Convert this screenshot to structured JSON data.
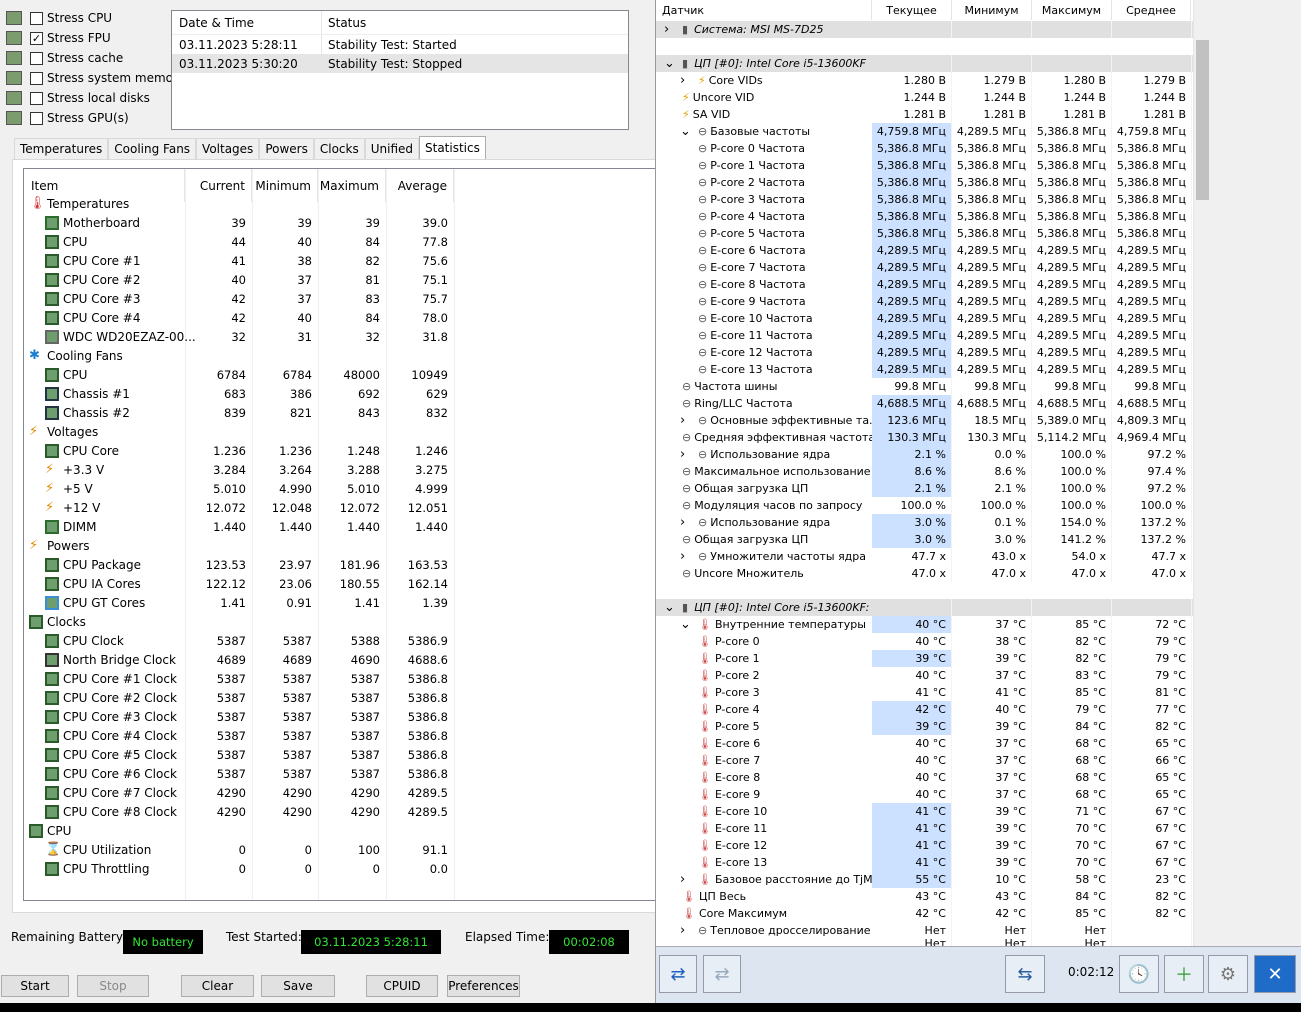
{
  "stress_options": [
    {
      "label": "Stress CPU",
      "checked": false
    },
    {
      "label": "Stress FPU",
      "checked": true
    },
    {
      "label": "Stress cache",
      "checked": false
    },
    {
      "label": "Stress system memory",
      "checked": false
    },
    {
      "label": "Stress local disks",
      "checked": false
    },
    {
      "label": "Stress GPU(s)",
      "checked": false
    }
  ],
  "events": {
    "col_datetime": "Date & Time",
    "col_status": "Status",
    "rows": [
      {
        "datetime": "03.11.2023 5:28:11",
        "status": "Stability Test: Started"
      },
      {
        "datetime": "03.11.2023 5:30:20",
        "status": "Stability Test: Stopped"
      }
    ]
  },
  "tabs": [
    "Temperatures",
    "Cooling Fans",
    "Voltages",
    "Powers",
    "Clocks",
    "Unified",
    "Statistics"
  ],
  "stats": {
    "columns": [
      "Item",
      "Current",
      "Minimum",
      "Maximum",
      "Average"
    ],
    "rows": [
      {
        "group": true,
        "name": "Temperatures",
        "icon": "thermometer-icon"
      },
      {
        "name": "Motherboard",
        "icon": "motherboard-icon",
        "v": [
          "39",
          "39",
          "39",
          "39.0"
        ]
      },
      {
        "name": "CPU",
        "icon": "chip-icon",
        "v": [
          "44",
          "40",
          "84",
          "77.8"
        ]
      },
      {
        "name": "CPU Core #1",
        "icon": "chip-icon",
        "v": [
          "41",
          "38",
          "82",
          "75.6"
        ]
      },
      {
        "name": "CPU Core #2",
        "icon": "chip-icon",
        "v": [
          "40",
          "37",
          "81",
          "75.1"
        ]
      },
      {
        "name": "CPU Core #3",
        "icon": "chip-icon",
        "v": [
          "42",
          "37",
          "83",
          "75.7"
        ]
      },
      {
        "name": "CPU Core #4",
        "icon": "chip-icon",
        "v": [
          "42",
          "40",
          "84",
          "78.0"
        ]
      },
      {
        "name": "WDC WD20EZAZ-00...",
        "icon": "disk-icon",
        "v": [
          "32",
          "31",
          "32",
          "31.8"
        ]
      },
      {
        "group": true,
        "name": "Cooling Fans",
        "icon": "fan-icon"
      },
      {
        "name": "CPU",
        "icon": "chip-icon",
        "v": [
          "6784",
          "6784",
          "48000",
          "10949"
        ]
      },
      {
        "name": "Chassis #1",
        "icon": "case-icon",
        "v": [
          "683",
          "386",
          "692",
          "629"
        ]
      },
      {
        "name": "Chassis #2",
        "icon": "case-icon",
        "v": [
          "839",
          "821",
          "843",
          "832"
        ]
      },
      {
        "group": true,
        "name": "Voltages",
        "icon": "bolt-icon"
      },
      {
        "name": "CPU Core",
        "icon": "chip-icon",
        "v": [
          "1.236",
          "1.236",
          "1.248",
          "1.246"
        ]
      },
      {
        "name": "+3.3 V",
        "icon": "bolt-icon",
        "v": [
          "3.284",
          "3.264",
          "3.288",
          "3.275"
        ]
      },
      {
        "name": "+5 V",
        "icon": "bolt-icon",
        "v": [
          "5.010",
          "4.990",
          "5.010",
          "4.999"
        ]
      },
      {
        "name": "+12 V",
        "icon": "bolt-icon",
        "v": [
          "12.072",
          "12.048",
          "12.072",
          "12.051"
        ]
      },
      {
        "name": "DIMM",
        "icon": "memory-icon",
        "v": [
          "1.440",
          "1.440",
          "1.440",
          "1.440"
        ]
      },
      {
        "group": true,
        "name": "Powers",
        "icon": "bolt-icon"
      },
      {
        "name": "CPU Package",
        "icon": "chip-icon",
        "v": [
          "123.53",
          "23.97",
          "181.96",
          "163.53"
        ]
      },
      {
        "name": "CPU IA Cores",
        "icon": "chip-icon",
        "v": [
          "122.12",
          "23.06",
          "180.55",
          "162.14"
        ]
      },
      {
        "name": "CPU GT Cores",
        "icon": "monitor-icon",
        "v": [
          "1.41",
          "0.91",
          "1.41",
          "1.39"
        ]
      },
      {
        "group": true,
        "name": "Clocks",
        "icon": "chip-icon"
      },
      {
        "name": "CPU Clock",
        "icon": "chip-icon",
        "v": [
          "5387",
          "5387",
          "5388",
          "5386.9"
        ]
      },
      {
        "name": "North Bridge Clock",
        "icon": "chipset-icon",
        "v": [
          "4689",
          "4689",
          "4690",
          "4688.6"
        ]
      },
      {
        "name": "CPU Core #1 Clock",
        "icon": "chip-icon",
        "v": [
          "5387",
          "5387",
          "5387",
          "5386.8"
        ]
      },
      {
        "name": "CPU Core #2 Clock",
        "icon": "chip-icon",
        "v": [
          "5387",
          "5387",
          "5387",
          "5386.8"
        ]
      },
      {
        "name": "CPU Core #3 Clock",
        "icon": "chip-icon",
        "v": [
          "5387",
          "5387",
          "5387",
          "5386.8"
        ]
      },
      {
        "name": "CPU Core #4 Clock",
        "icon": "chip-icon",
        "v": [
          "5387",
          "5387",
          "5387",
          "5386.8"
        ]
      },
      {
        "name": "CPU Core #5 Clock",
        "icon": "chip-icon",
        "v": [
          "5387",
          "5387",
          "5387",
          "5386.8"
        ]
      },
      {
        "name": "CPU Core #6 Clock",
        "icon": "chip-icon",
        "v": [
          "5387",
          "5387",
          "5387",
          "5386.8"
        ]
      },
      {
        "name": "CPU Core #7 Clock",
        "icon": "chip-icon",
        "v": [
          "4290",
          "4290",
          "4290",
          "4289.5"
        ]
      },
      {
        "name": "CPU Core #8 Clock",
        "icon": "chip-icon",
        "v": [
          "4290",
          "4290",
          "4290",
          "4289.5"
        ]
      },
      {
        "group": true,
        "name": "CPU",
        "icon": "chip-icon"
      },
      {
        "name": "CPU Utilization",
        "icon": "hourglass-icon",
        "v": [
          "0",
          "0",
          "100",
          "91.1"
        ]
      },
      {
        "name": "CPU Throttling",
        "icon": "chip-icon",
        "v": [
          "0",
          "0",
          "0",
          "0.0"
        ]
      }
    ]
  },
  "status": {
    "battery_label": "Remaining Battery:",
    "battery_value": "No battery",
    "started_label": "Test Started:",
    "started_value": "03.11.2023 5:28:11",
    "elapsed_label": "Elapsed Time:",
    "elapsed_value": "00:02:08"
  },
  "buttons": {
    "start": "Start",
    "stop": "Stop",
    "clear": "Clear",
    "save": "Save",
    "cpuid": "CPUID",
    "preferences": "Preferences"
  },
  "hwinfo": {
    "columns": [
      "Датчик",
      "Текущее",
      "Минимум",
      "Максимум",
      "Среднее"
    ],
    "time": "0:02:12",
    "rows": [
      {
        "t": "sec",
        "name": "Система: MSI MS-7D25",
        "exp": ">",
        "ind": 0
      },
      {
        "t": "blank"
      },
      {
        "t": "sec",
        "name": "ЦП [#0]: Intel Core i5-13600KF",
        "exp": "v",
        "ind": 0
      },
      {
        "name": "Core VIDs",
        "exp": ">",
        "ind": 1,
        "icon": "bolt-icon",
        "v": [
          "1.280 В",
          "1.279 В",
          "1.280 В",
          "1.279 В"
        ]
      },
      {
        "name": "Uncore VID",
        "ind": 0,
        "icon": "bolt-icon",
        "v": [
          "1.244 В",
          "1.244 В",
          "1.244 В",
          "1.244 В"
        ]
      },
      {
        "name": "SA VID",
        "ind": 0,
        "icon": "bolt-icon",
        "v": [
          "1.281 В",
          "1.281 В",
          "1.281 В",
          "1.281 В"
        ]
      },
      {
        "name": "Базовые частоты",
        "exp": "v",
        "ind": 1,
        "icon": "clock-icon",
        "hl": true,
        "v": [
          "4,759.8 МГц",
          "4,289.5 МГц",
          "5,386.8 МГц",
          "4,759.8 МГц"
        ]
      },
      {
        "name": "P-core 0 Частота",
        "ind": 2,
        "icon": "clock-icon",
        "hl": true,
        "v": [
          "5,386.8 МГц",
          "5,386.8 МГц",
          "5,386.8 МГц",
          "5,386.8 МГц"
        ]
      },
      {
        "name": "P-core 1 Частота",
        "ind": 2,
        "icon": "clock-icon",
        "hl": true,
        "v": [
          "5,386.8 МГц",
          "5,386.8 МГц",
          "5,386.8 МГц",
          "5,386.8 МГц"
        ]
      },
      {
        "name": "P-core 2 Частота",
        "ind": 2,
        "icon": "clock-icon",
        "hl": true,
        "v": [
          "5,386.8 МГц",
          "5,386.8 МГц",
          "5,386.8 МГц",
          "5,386.8 МГц"
        ]
      },
      {
        "name": "P-core 3 Частота",
        "ind": 2,
        "icon": "clock-icon",
        "hl": true,
        "v": [
          "5,386.8 МГц",
          "5,386.8 МГц",
          "5,386.8 МГц",
          "5,386.8 МГц"
        ]
      },
      {
        "name": "P-core 4 Частота",
        "ind": 2,
        "icon": "clock-icon",
        "hl": true,
        "v": [
          "5,386.8 МГц",
          "5,386.8 МГц",
          "5,386.8 МГц",
          "5,386.8 МГц"
        ]
      },
      {
        "name": "P-core 5 Частота",
        "ind": 2,
        "icon": "clock-icon",
        "hl": true,
        "v": [
          "5,386.8 МГц",
          "5,386.8 МГц",
          "5,386.8 МГц",
          "5,386.8 МГц"
        ]
      },
      {
        "name": "E-core 6 Частота",
        "ind": 2,
        "icon": "clock-icon",
        "hl": true,
        "v": [
          "4,289.5 МГц",
          "4,289.5 МГц",
          "4,289.5 МГц",
          "4,289.5 МГц"
        ]
      },
      {
        "name": "E-core 7 Частота",
        "ind": 2,
        "icon": "clock-icon",
        "hl": true,
        "v": [
          "4,289.5 МГц",
          "4,289.5 МГц",
          "4,289.5 МГц",
          "4,289.5 МГц"
        ]
      },
      {
        "name": "E-core 8 Частота",
        "ind": 2,
        "icon": "clock-icon",
        "hl": true,
        "v": [
          "4,289.5 МГц",
          "4,289.5 МГц",
          "4,289.5 МГц",
          "4,289.5 МГц"
        ]
      },
      {
        "name": "E-core 9 Частота",
        "ind": 2,
        "icon": "clock-icon",
        "hl": true,
        "v": [
          "4,289.5 МГц",
          "4,289.5 МГц",
          "4,289.5 МГц",
          "4,289.5 МГц"
        ]
      },
      {
        "name": "E-core 10 Частота",
        "ind": 2,
        "icon": "clock-icon",
        "hl": true,
        "v": [
          "4,289.5 МГц",
          "4,289.5 МГц",
          "4,289.5 МГц",
          "4,289.5 МГц"
        ]
      },
      {
        "name": "E-core 11 Частота",
        "ind": 2,
        "icon": "clock-icon",
        "hl": true,
        "v": [
          "4,289.5 МГц",
          "4,289.5 МГц",
          "4,289.5 МГц",
          "4,289.5 МГц"
        ]
      },
      {
        "name": "E-core 12 Частота",
        "ind": 2,
        "icon": "clock-icon",
        "hl": true,
        "v": [
          "4,289.5 МГц",
          "4,289.5 МГц",
          "4,289.5 МГц",
          "4,289.5 МГц"
        ]
      },
      {
        "name": "E-core 13 Частота",
        "ind": 2,
        "icon": "clock-icon",
        "hl": true,
        "v": [
          "4,289.5 МГц",
          "4,289.5 МГц",
          "4,289.5 МГц",
          "4,289.5 МГц"
        ]
      },
      {
        "name": "Частота шины",
        "ind": 0,
        "icon": "clock-icon",
        "v": [
          "99.8 МГц",
          "99.8 МГц",
          "99.8 МГц",
          "99.8 МГц"
        ]
      },
      {
        "name": "Ring/LLC Частота",
        "ind": 0,
        "icon": "clock-icon",
        "hl": true,
        "v": [
          "4,688.5 МГц",
          "4,688.5 МГц",
          "4,688.5 МГц",
          "4,688.5 МГц"
        ]
      },
      {
        "name": "Основные эффективные та...",
        "exp": ">",
        "ind": 1,
        "icon": "clock-icon",
        "hl": true,
        "v": [
          "123.6 МГц",
          "18.5 МГц",
          "5,389.0 МГц",
          "4,809.3 МГц"
        ]
      },
      {
        "name": "Средняя эффективная частота",
        "ind": 0,
        "icon": "clock-icon",
        "hl": true,
        "v": [
          "130.3 МГц",
          "130.3 МГц",
          "5,114.2 МГц",
          "4,969.4 МГц"
        ]
      },
      {
        "name": "Использование ядра",
        "exp": ">",
        "ind": 1,
        "icon": "clock-icon",
        "hl": true,
        "v": [
          "2.1 %",
          "0.0 %",
          "100.0 %",
          "97.2 %"
        ]
      },
      {
        "name": "Максимальное использование ...",
        "ind": 0,
        "icon": "clock-icon",
        "hl": true,
        "v": [
          "8.6 %",
          "8.6 %",
          "100.0 %",
          "97.4 %"
        ]
      },
      {
        "name": "Общая загрузка ЦП",
        "ind": 0,
        "icon": "clock-icon",
        "hl": true,
        "v": [
          "2.1 %",
          "2.1 %",
          "100.0 %",
          "97.2 %"
        ]
      },
      {
        "name": "Модуляция часов по запросу",
        "ind": 0,
        "icon": "clock-icon",
        "v": [
          "100.0 %",
          "100.0 %",
          "100.0 %",
          "100.0 %"
        ]
      },
      {
        "name": "Использование ядра",
        "exp": ">",
        "ind": 1,
        "icon": "clock-icon",
        "hl": true,
        "v": [
          "3.0 %",
          "0.1 %",
          "154.0 %",
          "137.2 %"
        ]
      },
      {
        "name": "Общая загрузка ЦП",
        "ind": 0,
        "icon": "clock-icon",
        "hl": true,
        "v": [
          "3.0 %",
          "3.0 %",
          "141.2 %",
          "137.2 %"
        ]
      },
      {
        "name": "Умножители частоты ядра",
        "exp": ">",
        "ind": 1,
        "icon": "clock-icon",
        "v": [
          "47.7 x",
          "43.0 x",
          "54.0 x",
          "47.7 x"
        ]
      },
      {
        "name": "Uncore Множитель",
        "ind": 0,
        "icon": "clock-icon",
        "v": [
          "47.0 x",
          "47.0 x",
          "47.0 x",
          "47.0 x"
        ]
      },
      {
        "t": "blank"
      },
      {
        "t": "sec",
        "name": "ЦП [#0]: Intel Core i5-13600KF: ...",
        "exp": "v",
        "ind": 0
      },
      {
        "name": "Внутренние температуры",
        "exp": "v",
        "ind": 1,
        "icon": "thermometer-icon",
        "hl": true,
        "v": [
          "40 °C",
          "37 °C",
          "85 °C",
          "72 °C"
        ]
      },
      {
        "name": "P-core 0",
        "ind": 2,
        "icon": "thermometer-icon",
        "v": [
          "40 °C",
          "38 °C",
          "82 °C",
          "79 °C"
        ]
      },
      {
        "name": "P-core 1",
        "ind": 2,
        "icon": "thermometer-icon",
        "hl": true,
        "v": [
          "39 °C",
          "39 °C",
          "82 °C",
          "79 °C"
        ]
      },
      {
        "name": "P-core 2",
        "ind": 2,
        "icon": "thermometer-icon",
        "v": [
          "40 °C",
          "37 °C",
          "83 °C",
          "79 °C"
        ]
      },
      {
        "name": "P-core 3",
        "ind": 2,
        "icon": "thermometer-icon",
        "v": [
          "41 °C",
          "41 °C",
          "85 °C",
          "81 °C"
        ]
      },
      {
        "name": "P-core 4",
        "ind": 2,
        "icon": "thermometer-icon",
        "hl": true,
        "v": [
          "42 °C",
          "40 °C",
          "79 °C",
          "77 °C"
        ]
      },
      {
        "name": "P-core 5",
        "ind": 2,
        "icon": "thermometer-icon",
        "hl": true,
        "v": [
          "39 °C",
          "39 °C",
          "84 °C",
          "82 °C"
        ]
      },
      {
        "name": "E-core 6",
        "ind": 2,
        "icon": "thermometer-icon",
        "v": [
          "40 °C",
          "37 °C",
          "68 °C",
          "65 °C"
        ]
      },
      {
        "name": "E-core 7",
        "ind": 2,
        "icon": "thermometer-icon",
        "v": [
          "40 °C",
          "37 °C",
          "68 °C",
          "66 °C"
        ]
      },
      {
        "name": "E-core 8",
        "ind": 2,
        "icon": "thermometer-icon",
        "v": [
          "40 °C",
          "37 °C",
          "68 °C",
          "65 °C"
        ]
      },
      {
        "name": "E-core 9",
        "ind": 2,
        "icon": "thermometer-icon",
        "v": [
          "40 °C",
          "37 °C",
          "68 °C",
          "65 °C"
        ]
      },
      {
        "name": "E-core 10",
        "ind": 2,
        "icon": "thermometer-icon",
        "hl": true,
        "v": [
          "41 °C",
          "39 °C",
          "71 °C",
          "67 °C"
        ]
      },
      {
        "name": "E-core 11",
        "ind": 2,
        "icon": "thermometer-icon",
        "hl": true,
        "v": [
          "41 °C",
          "39 °C",
          "70 °C",
          "67 °C"
        ]
      },
      {
        "name": "E-core 12",
        "ind": 2,
        "icon": "thermometer-icon",
        "hl": true,
        "v": [
          "41 °C",
          "39 °C",
          "70 °C",
          "67 °C"
        ]
      },
      {
        "name": "E-core 13",
        "ind": 2,
        "icon": "thermometer-icon",
        "hl": true,
        "v": [
          "41 °C",
          "39 °C",
          "70 °C",
          "67 °C"
        ]
      },
      {
        "name": "Базовое расстояние до TjMAX",
        "exp": ">",
        "ind": 1,
        "icon": "thermometer-icon",
        "hl": true,
        "v": [
          "55 °C",
          "10 °C",
          "58 °C",
          "23 °C"
        ]
      },
      {
        "name": "ЦП Весь",
        "ind": 0,
        "icon": "thermometer-icon",
        "v": [
          "43 °C",
          "43 °C",
          "84 °C",
          "82 °C"
        ]
      },
      {
        "name": "Core Максимум",
        "ind": 0,
        "icon": "thermometer-icon",
        "v": [
          "42 °C",
          "42 °C",
          "85 °C",
          "82 °C"
        ]
      },
      {
        "name": "Тепловое дросселирование ...",
        "exp": ">",
        "ind": 1,
        "icon": "clock-icon",
        "v": [
          "Нет",
          "Нет",
          "Нет",
          ""
        ]
      },
      {
        "name": "",
        "ind": 0,
        "icon": "",
        "v": [
          "Нет",
          "Нет",
          "Нет",
          ""
        ],
        "partial": true
      }
    ]
  }
}
